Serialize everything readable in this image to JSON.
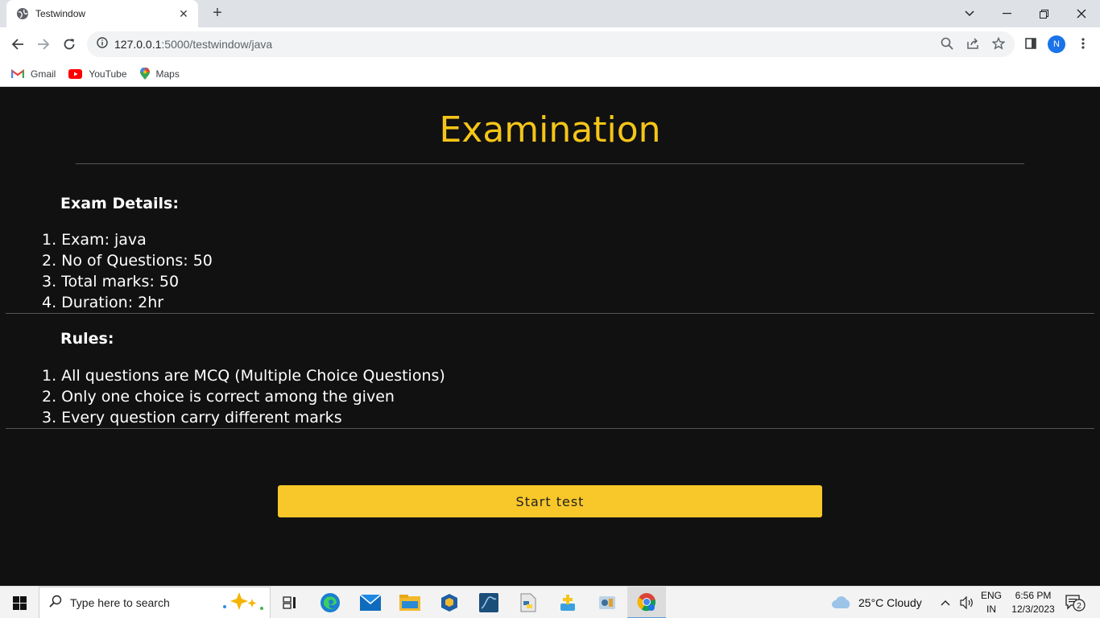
{
  "browser": {
    "tab_title": "Testwindow",
    "url_host": "127.0.0.1",
    "url_path": ":5000/testwindow/java",
    "avatar_letter": "N",
    "bookmarks": [
      {
        "label": "Gmail",
        "icon": "gmail-icon"
      },
      {
        "label": "YouTube",
        "icon": "youtube-icon"
      },
      {
        "label": "Maps",
        "icon": "maps-icon"
      }
    ]
  },
  "page": {
    "heading": "Examination",
    "details_title": "Exam Details:",
    "details": [
      "1. Exam: java",
      "2. No of Questions: 50",
      "3. Total marks: 50",
      "4. Duration: 2hr"
    ],
    "rules_title": "Rules:",
    "rules": [
      "1. All questions are MCQ (Multiple Choice Questions)",
      "2. Only one choice is correct among the given",
      "3. Every question carry different marks"
    ],
    "start_button": "Start test"
  },
  "colors": {
    "accent": "#f8c72a",
    "heading": "#f5c518",
    "background": "#111111"
  },
  "taskbar": {
    "search_placeholder": "Type here to search",
    "weather": "25°C  Cloudy",
    "lang_top": "ENG",
    "lang_bottom": "IN",
    "time": "6:56 PM",
    "date": "12/3/2023",
    "notification_count": "2"
  }
}
